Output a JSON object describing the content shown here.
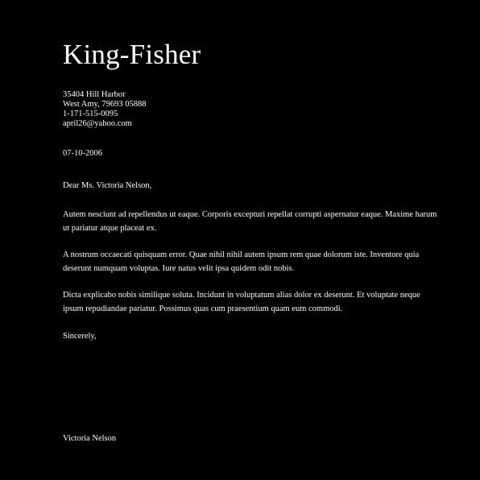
{
  "letter": {
    "sender_name": "King-Fisher",
    "address": {
      "street": "35404 Hill Harbor",
      "city_line": "West Amy, 79693 05888",
      "phone": "1-171-515-0095",
      "email": "april26@yahoo.com"
    },
    "date": "07-10-2006",
    "salutation": "Dear Ms. Victoria Nelson,",
    "paragraphs": [
      "Autem nesciunt ad repellendus ut eaque. Corporis excepturi repellat corrupti aspernatur eaque. Maxime harum ut pariatur atque placeat ex.",
      "A nostrum occaecati quisquam error. Quae nihil nihil autem ipsum rem quae dolorum iste. Inventore quia deserunt numquam voluptas. Iure natus velit ipsa quidem odit nobis.",
      "Dicta explicabo nobis similique soluta. Incidunt in voluptatum alias dolor ex deserunt. Et voluptate neque ipsum repudiandae pariatur. Possimus quas cum praesentium quam eum commodi."
    ],
    "closing": "Sincerely,",
    "signature": "Victoria Nelson"
  },
  "colors": {
    "background": "#000000",
    "text": "#ffffff"
  }
}
